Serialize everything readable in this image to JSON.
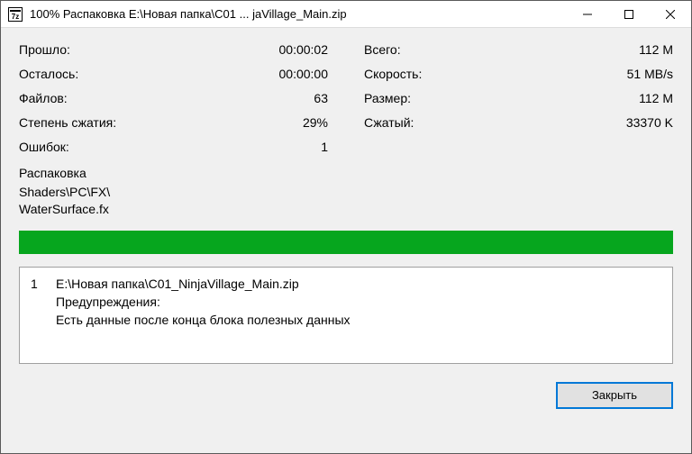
{
  "titlebar": {
    "title": "100% Распаковка E:\\Новая папка\\C01 ... jaVillage_Main.zip"
  },
  "stats": {
    "left": {
      "elapsed_label": "Прошло:",
      "elapsed_value": "00:00:02",
      "remaining_label": "Осталось:",
      "remaining_value": "00:00:00",
      "files_label": "Файлов:",
      "files_value": "63",
      "ratio_label": "Степень сжатия:",
      "ratio_value": "29%",
      "errors_label": "Ошибок:",
      "errors_value": "1"
    },
    "right": {
      "total_label": "Всего:",
      "total_value": "112 M",
      "speed_label": "Скорость:",
      "speed_value": "51 MB/s",
      "size_label": "Размер:",
      "size_value": "112 M",
      "packed_label": "Сжатый:",
      "packed_value": "33370 K"
    }
  },
  "extraction": {
    "label": "Распаковка",
    "path": "Shaders\\PC\\FX\\\nWaterSurface.fx"
  },
  "progress": {
    "percent": 100
  },
  "messages": {
    "id": "1",
    "file": "E:\\Новая папка\\C01_NinjaVillage_Main.zip",
    "warn_label": "Предупреждения:",
    "warn_text": "Есть данные после конца блока полезных данных"
  },
  "buttons": {
    "close": "Закрыть"
  }
}
